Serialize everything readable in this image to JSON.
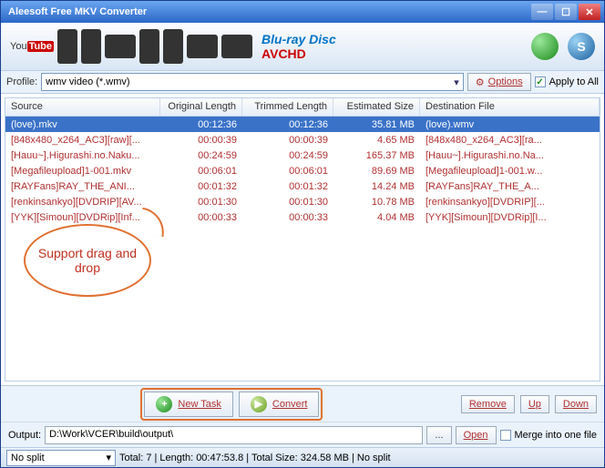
{
  "window": {
    "title": "Aleesoft Free MKV Converter"
  },
  "banner": {
    "youtube_label": "You",
    "youtube_bold": "Tube",
    "bluray": "Blu-ray Disc",
    "avchd": "AVCHD",
    "s_label": "S"
  },
  "profile": {
    "label": "Profile:",
    "value": "wmv video (*.wmv)",
    "options_btn": "Options",
    "apply_label": "Apply to All",
    "apply_checked": "✓"
  },
  "columns": {
    "source": "Source",
    "original_length": "Original Length",
    "trimmed_length": "Trimmed Length",
    "estimated_size": "Estimated Size",
    "destination": "Destination File"
  },
  "rows": [
    {
      "src": "(love).mkv",
      "ol": "00:12:36",
      "tl": "00:12:36",
      "es": "35.81 MB",
      "df": "(love).wmv",
      "sel": true
    },
    {
      "src": "[848x480_x264_AC3][raw][...",
      "ol": "00:00:39",
      "tl": "00:00:39",
      "es": "4.65 MB",
      "df": "[848x480_x264_AC3][ra..."
    },
    {
      "src": "[Hauu~].Higurashi.no.Naku...",
      "ol": "00:24:59",
      "tl": "00:24:59",
      "es": "165.37 MB",
      "df": "[Hauu~].Higurashi.no.Na..."
    },
    {
      "src": "[Megafileupload]1-001.mkv",
      "ol": "00:06:01",
      "tl": "00:06:01",
      "es": "89.69 MB",
      "df": "[Megafileupload]1-001.w..."
    },
    {
      "src": "[RAYFans]RAY_THE_ANI...",
      "ol": "00:01:32",
      "tl": "00:01:32",
      "es": "14.24 MB",
      "df": "[RAYFans]RAY_THE_A..."
    },
    {
      "src": "[renkinsankyo][DVDRIP][AV...",
      "ol": "00:01:30",
      "tl": "00:01:30",
      "es": "10.78 MB",
      "df": "[renkinsankyo][DVDRIP][..."
    },
    {
      "src": "[YYK][Simoun][DVDRip][Inf...",
      "ol": "00:00:33",
      "tl": "00:00:33",
      "es": "4.04 MB",
      "df": "[YYK][Simoun][DVDRip][I..."
    }
  ],
  "callout": "Support drag and drop",
  "actions": {
    "new_task": "New Task",
    "convert": "Convert",
    "remove": "Remove",
    "up": "Up",
    "down": "Down"
  },
  "output": {
    "label": "Output:",
    "path": "D:\\Work\\VCER\\build\\output\\",
    "browse": "...",
    "open": "Open",
    "merge_label": "Merge into one file"
  },
  "status": {
    "split": "No split",
    "summary": "Total: 7 | Length: 00:47:53.8 | Total Size: 324.58 MB | No split"
  }
}
